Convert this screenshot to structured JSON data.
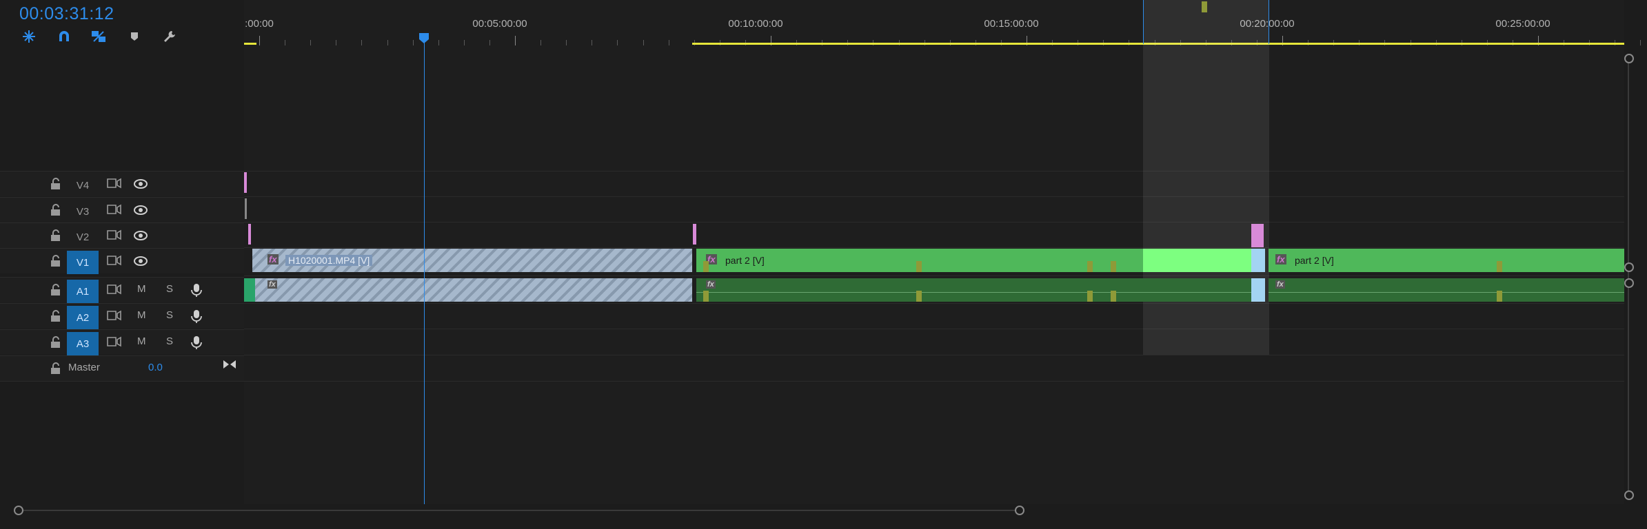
{
  "timecode": "00:03:31:12",
  "toolbar": {
    "tools": [
      {
        "name": "insert-overwrite-icon"
      },
      {
        "name": "snap-icon"
      },
      {
        "name": "linked-selection-icon"
      },
      {
        "name": "add-marker-icon"
      },
      {
        "name": "wrench-icon"
      }
    ]
  },
  "ruler": {
    "labels": [
      ":00:00",
      "00:05:00:00",
      "00:10:00:00",
      "00:15:00:00",
      "00:20:00:00",
      "00:25:00:00"
    ]
  },
  "tracks": {
    "video": [
      {
        "label": "V4",
        "targeted": false
      },
      {
        "label": "V3",
        "targeted": false
      },
      {
        "label": "V2",
        "targeted": false
      },
      {
        "label": "V1",
        "targeted": true
      }
    ],
    "audio": [
      {
        "label": "A1",
        "mute": "M",
        "solo": "S",
        "targeted": true
      },
      {
        "label": "A2",
        "mute": "M",
        "solo": "S",
        "targeted": true
      },
      {
        "label": "A3",
        "mute": "M",
        "solo": "S",
        "targeted": true
      }
    ],
    "master": {
      "label": "Master",
      "value": "0.0"
    }
  },
  "clips": {
    "v1_first": "H1020001.MP4 [V]",
    "v1_second": "part 2 [V]",
    "v1_third": "part 2 [V]",
    "fx": "fx"
  },
  "colors": {
    "accent": "#2d8ceb",
    "target": "#1668a8",
    "video_clip": "#4fb85a",
    "audio_clip": "#2f6b35",
    "selected_clip": "#7dff80",
    "hatched_clip": "#a6b8cc",
    "marker": "#b0a341",
    "transition": "#d88ad8",
    "work_area": "#e6e63a"
  }
}
